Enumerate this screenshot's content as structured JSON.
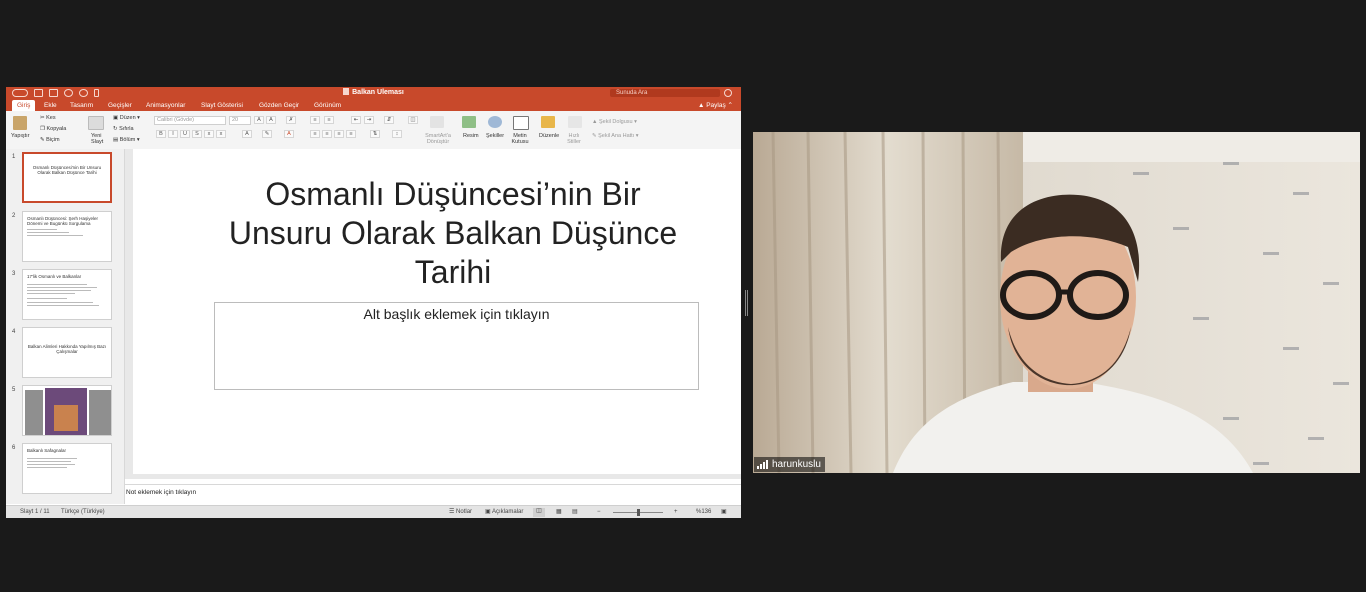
{
  "window": {
    "title": "Balkan Uleması",
    "search_placeholder": "Sunuda Ara"
  },
  "tabs": [
    "Giriş",
    "Ekle",
    "Tasarım",
    "Geçişler",
    "Animasyonlar",
    "Slayt Gösterisi",
    "Gözden Geçir",
    "Görünüm"
  ],
  "share_label": "Paylaş",
  "ribbon": {
    "paste": "Yapıştır",
    "cut": "Kes",
    "copy": "Kopyala",
    "format": "Biçim",
    "new_slide": "Yeni Slayt",
    "layout": "Düzen",
    "reset": "Sıfırla",
    "section": "Bölüm",
    "font_name": "Calibri (Gövde)",
    "font_size": "20",
    "smartart": "SmartArt'a Dönüştür",
    "picture": "Resim",
    "shapes": "Şekiller",
    "textbox": "Metin Kutusu",
    "arrange": "Düzenle",
    "quick_styles": "Hızlı Stiller",
    "shape_fill": "Şekil Dolgusu",
    "shape_outline": "Şekil Ana Hattı"
  },
  "thumbnails": [
    {
      "num": "1",
      "text": "Osmanlı Düşüncesi'nin Bir Unsuru Olarak Balkan Düşünce Tarihi"
    },
    {
      "num": "2",
      "text": "Osmanlı Düşüncesi: Şerh Haşiyeler Dönemi ve Bugünkü Sorgulama"
    },
    {
      "num": "3",
      "text": "17'lik Osmanlı ve Balkanlar"
    },
    {
      "num": "4",
      "text": "Balkan Alimleri Hakkında Yapılmış Bazı Çalışmalar"
    },
    {
      "num": "5",
      "text": ""
    },
    {
      "num": "6",
      "text": "Balkanlı Safagnalar"
    }
  ],
  "slide": {
    "title_lines": [
      "Osmanlı Düşüncesi’nin Bir",
      "Unsuru Olarak Balkan Düşünce",
      "Tarihi"
    ],
    "subtitle_placeholder": "Alt başlık eklemek için tıklayın"
  },
  "notes_placeholder": "Not eklemek için tıklayın",
  "status": {
    "slide_info": "Slayt 1 / 11",
    "language": "Türkçe (Türkiye)",
    "notes": "Notlar",
    "comments": "Açıklamalar",
    "zoom": "%136"
  },
  "video": {
    "username": "harunkuslu"
  },
  "colors": {
    "accent": "#c8492b",
    "background": "#1a1a1a"
  }
}
